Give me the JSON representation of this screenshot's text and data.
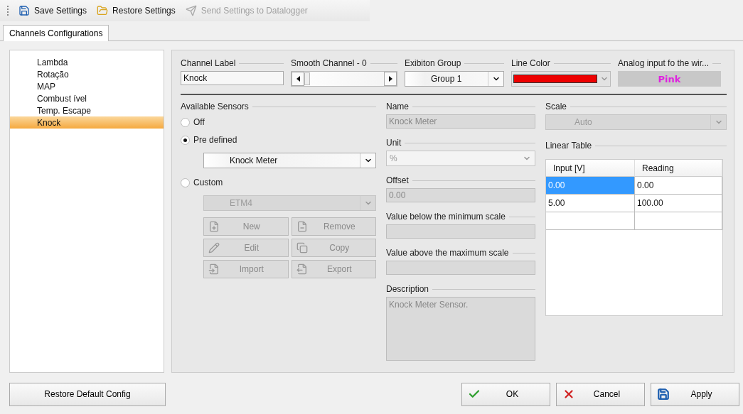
{
  "toolbar": [
    {
      "label": "Save Settings",
      "disabled": false
    },
    {
      "label": "Restore Settings",
      "disabled": false
    },
    {
      "label": "Send Settings to Datalogger",
      "disabled": true
    }
  ],
  "tabs": [
    {
      "label": "Channels Configurations",
      "selected": true
    }
  ],
  "channels": [
    {
      "label": "Lambda",
      "selected": false
    },
    {
      "label": "Rotação",
      "selected": false
    },
    {
      "label": "MAP",
      "selected": false
    },
    {
      "label": "Combust ível",
      "selected": false
    },
    {
      "label": "Temp. Escape",
      "selected": false
    },
    {
      "label": "Knock",
      "selected": true
    }
  ],
  "header": {
    "channel_label": {
      "label": "Channel Label",
      "value": "Knock"
    },
    "smooth": {
      "label": "Smooth Channel - 0"
    },
    "group": {
      "label": "Exibiton Group",
      "value": "Group 1"
    },
    "line_color": {
      "label": "Line Color",
      "color": "#ee0000"
    },
    "analog": {
      "label": "Analog input fo the wir...",
      "value": "Pink",
      "color": "#e020e0"
    }
  },
  "sensors": {
    "title": "Available Sensors",
    "options": [
      {
        "label": "Off",
        "selected": false
      },
      {
        "label": "Pre defined",
        "selected": true
      },
      {
        "label": "Custom",
        "selected": false
      }
    ],
    "predefined_value": "Knock Meter",
    "custom_value": "ETM4",
    "buttons": [
      {
        "label": "New",
        "disabled": true
      },
      {
        "label": "Remove",
        "disabled": true
      },
      {
        "label": "Edit",
        "disabled": true
      },
      {
        "label": "Copy",
        "disabled": true
      },
      {
        "label": "Import",
        "disabled": true
      },
      {
        "label": "Export",
        "disabled": true
      }
    ]
  },
  "details": {
    "name": {
      "label": "Name",
      "value": "Knock Meter",
      "disabled": true
    },
    "unit": {
      "label": "Unit",
      "value": "%"
    },
    "offset": {
      "label": "Offset",
      "value": "0.00",
      "disabled": true
    },
    "below": {
      "label": "Value below the minimum scale"
    },
    "above": {
      "label": "Value above the maximum scale"
    },
    "description": {
      "label": "Description",
      "value": "Knock Meter Sensor.",
      "disabled": true
    }
  },
  "scale": {
    "label": "Scale",
    "value": "Auto"
  },
  "linear_table": {
    "title": "Linear Table",
    "columns": [
      "Input [V]",
      "Reading"
    ],
    "rows": [
      {
        "cells": [
          "0.00",
          "0.00"
        ],
        "selected": true
      },
      {
        "cells": [
          "5.00",
          "100.00"
        ],
        "selected": false
      },
      {
        "cells": [],
        "selected": false
      }
    ]
  },
  "footer": {
    "restore": "Restore Default Config",
    "buttons": [
      {
        "kind": "ok",
        "label": "OK"
      },
      {
        "kind": "cancel",
        "label": "Cancel"
      },
      {
        "kind": "apply",
        "label": "Apply"
      }
    ]
  }
}
